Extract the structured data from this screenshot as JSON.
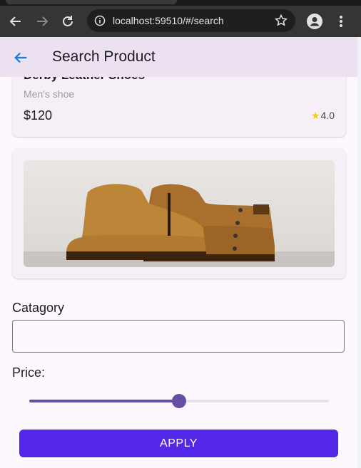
{
  "browser": {
    "url": "localhost:59510/#/search"
  },
  "appbar": {
    "title": "Search Product"
  },
  "product": {
    "name": "Derby Leather Shoes",
    "category": "Men's shoe",
    "price": "$120",
    "rating": "4.0"
  },
  "filters": {
    "category_label": "Catagory",
    "category_value": "",
    "price_label": "Price:",
    "price_fraction": 0.5
  },
  "apply_label": "APPLY",
  "colors": {
    "accent": "#6750a4",
    "button": "#5227e8",
    "appbar": "#ebe1f1",
    "star": "#f6d000"
  }
}
